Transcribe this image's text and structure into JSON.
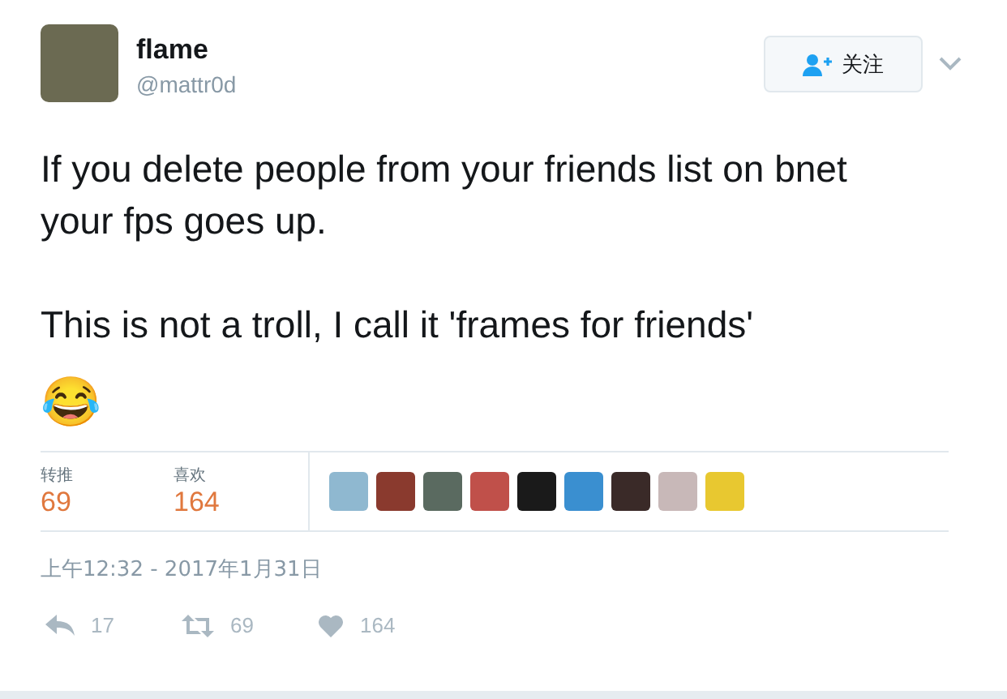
{
  "author": {
    "name": "flame",
    "handle": "@mattr0d"
  },
  "follow_button": {
    "label": "关注"
  },
  "tweet": {
    "paragraphs": [
      "If you delete people from your friends list on bnet your fps goes up.",
      "This is not a troll, I call it 'frames for friends'"
    ],
    "emoji": "😂"
  },
  "stats": [
    {
      "label": "转推",
      "value": "69"
    },
    {
      "label": "喜欢",
      "value": "164"
    }
  ],
  "timestamp": "上午12:32 - 2017年1月31日",
  "actions": [
    {
      "kind": "reply",
      "count": "17"
    },
    {
      "kind": "retweet",
      "count": "69"
    },
    {
      "kind": "like",
      "count": "164"
    }
  ]
}
